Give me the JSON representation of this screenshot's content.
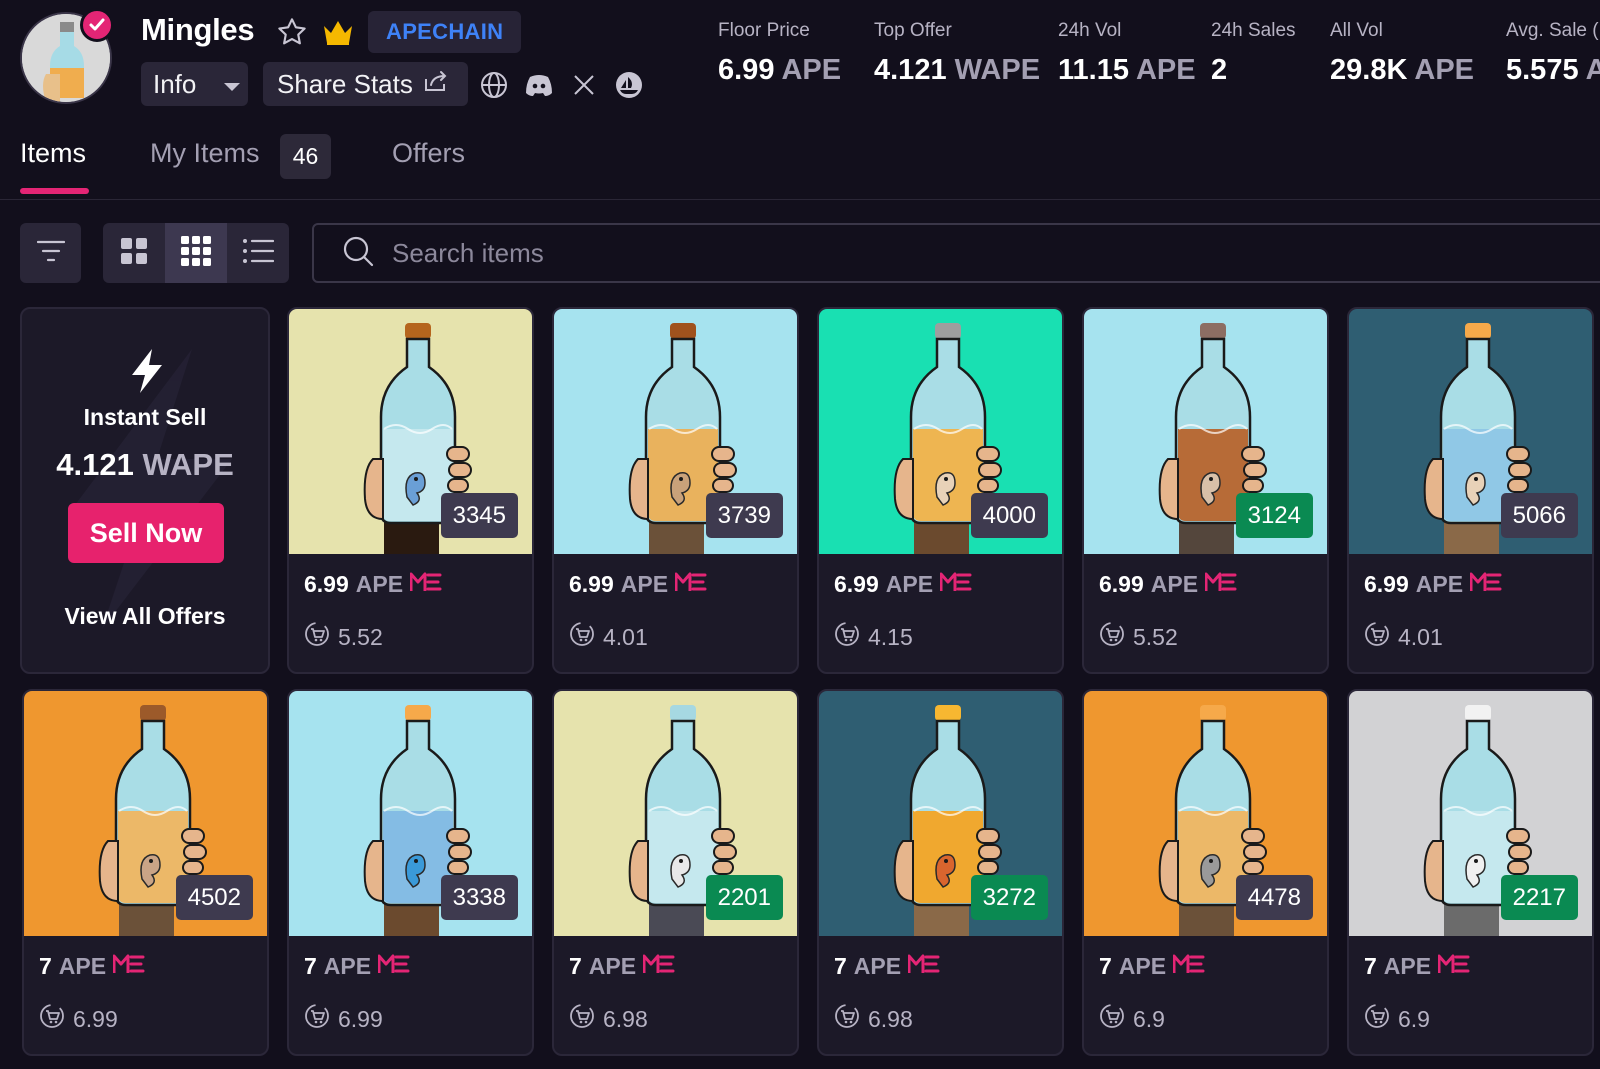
{
  "collection": {
    "name": "Mingles",
    "chain": "APECHAIN",
    "info_label": "Info",
    "share_label": "Share Stats"
  },
  "stats": [
    {
      "label": "Floor Price",
      "value": "6.99",
      "unit": "APE"
    },
    {
      "label": "Top Offer",
      "value": "4.121",
      "unit": "WAPE"
    },
    {
      "label": "24h Vol",
      "value": "11.15",
      "unit": "APE"
    },
    {
      "label": "24h Sales",
      "value": "2",
      "unit": ""
    },
    {
      "label": "All Vol",
      "value": "29.8K",
      "unit": "APE"
    },
    {
      "label": "Avg. Sale (",
      "value": "5.575",
      "unit": "A"
    }
  ],
  "tabs": {
    "items": "Items",
    "my_items": "My Items",
    "my_items_count": "46",
    "offers": "Offers"
  },
  "search": {
    "placeholder": "Search items"
  },
  "instant_sell": {
    "title": "Instant Sell",
    "amount": "4.121",
    "unit": "WAPE",
    "button": "Sell Now",
    "view_all": "View All Offers"
  },
  "items": [
    {
      "id": "3345",
      "price": "6.99",
      "unit": "APE",
      "last": "5.52",
      "tag_color": "gray",
      "bg": "#e6e3ad",
      "liquid": "#c8e9ee",
      "cap": "#b5651d",
      "arm": "#2a1a10",
      "worm": "#6a9fd6"
    },
    {
      "id": "3739",
      "price": "6.99",
      "unit": "APE",
      "last": "4.01",
      "tag_color": "gray",
      "bg": "#a6e3ef",
      "liquid": "#f0ad4e",
      "cap": "#a0521d",
      "arm": "#6b5139",
      "worm": "#c9a27a"
    },
    {
      "id": "4000",
      "price": "6.99",
      "unit": "APE",
      "last": "4.15",
      "tag_color": "gray",
      "bg": "#19e0b2",
      "liquid": "#f5b040",
      "cap": "#9e9e9e",
      "arm": "#6b4a2e",
      "worm": "#e8d2b8"
    },
    {
      "id": "3124",
      "price": "6.99",
      "unit": "APE",
      "last": "5.52",
      "tag_color": "green",
      "bg": "#a6e3ef",
      "liquid": "#b85e24",
      "cap": "#8d6e63",
      "arm": "#54463c",
      "worm": "#d8c0a8"
    },
    {
      "id": "5066",
      "price": "6.99",
      "unit": "APE",
      "last": "4.01",
      "tag_color": "gray",
      "bg": "#2f5e72",
      "liquid": "#8dc5e5",
      "cap": "#f6a94a",
      "arm": "#8a6948",
      "worm": "#e8d2b8"
    },
    {
      "id": "4502",
      "price": "7",
      "unit": "APE",
      "last": "6.99",
      "tag_color": "gray",
      "bg": "#ef972f",
      "liquid": "#f3b45a",
      "cap": "#9c5a2a",
      "arm": "#6b5139",
      "worm": "#caa486"
    },
    {
      "id": "3338",
      "price": "7",
      "unit": "APE",
      "last": "6.99",
      "tag_color": "gray",
      "bg": "#a6e3ef",
      "liquid": "#7fb8e3",
      "cap": "#f6a94a",
      "arm": "#6b4a2e",
      "worm": "#3a9ad9"
    },
    {
      "id": "2201",
      "price": "7",
      "unit": "APE",
      "last": "6.98",
      "tag_color": "green",
      "bg": "#e6e3ad",
      "liquid": "#c8e9ee",
      "cap": "#a6d8e2",
      "arm": "#4a4a55",
      "worm": "#e8e8e8"
    },
    {
      "id": "3272",
      "price": "7",
      "unit": "APE",
      "last": "6.98",
      "tag_color": "green",
      "bg": "#2f5e72",
      "liquid": "#f7a21b",
      "cap": "#f7b731",
      "arm": "#8a6948",
      "worm": "#d9652e"
    },
    {
      "id": "4478",
      "price": "7",
      "unit": "APE",
      "last": "6.9",
      "tag_color": "gray",
      "bg": "#ef972f",
      "liquid": "#f3b45a",
      "cap": "#f6a94a",
      "arm": "#6b5139",
      "worm": "#9a9a9a"
    },
    {
      "id": "2217",
      "price": "7",
      "unit": "APE",
      "last": "6.9",
      "tag_color": "green",
      "bg": "#d2d2d4",
      "liquid": "#c8e9ee",
      "cap": "#f2f2f2",
      "arm": "#6b6b6b",
      "worm": "#f0f0f0"
    }
  ],
  "colors": {
    "accent": "#e42575",
    "chain": "#3e82f7",
    "green_tag": "#0a8a52",
    "bg": "#120f1c"
  },
  "icons": [
    "star-icon",
    "crown-icon",
    "chevron-down-icon",
    "share-icon",
    "globe-icon",
    "discord-icon",
    "x-icon",
    "opensea-icon",
    "filter-icon",
    "grid-large-icon",
    "grid-small-icon",
    "list-icon",
    "search-icon",
    "bolt-icon",
    "magic-eden-icon",
    "cart-icon"
  ]
}
